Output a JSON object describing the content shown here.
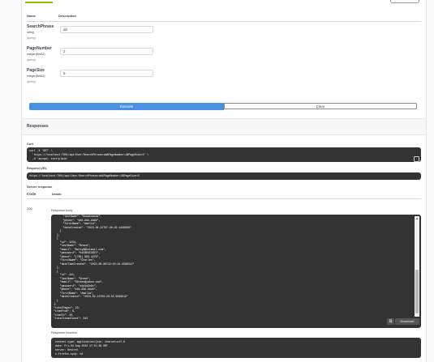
{
  "params_table": {
    "name_header": "Name",
    "desc_header": "Description"
  },
  "params": [
    {
      "name": "SearchPhrase",
      "type": "string",
      "in": "(query)",
      "value": "ab"
    },
    {
      "name": "PageNumber",
      "type": "integer($int32)",
      "in": "(query)",
      "value": "2"
    },
    {
      "name": "PageSize",
      "type": "integer($int32)",
      "in": "(query)",
      "value": "5"
    }
  ],
  "buttons": {
    "execute": "Execute",
    "clear": "Clear"
  },
  "responses_title": "Responses",
  "curl": {
    "label": "Curl",
    "lines": [
      "curl -X 'GET' \\",
      "  'https://localhost:7001/api/User/SearchPhrase=ab&PageNumber=2&PageSize=5' \\",
      "  -H 'accept: text/plain'"
    ]
  },
  "request_url": {
    "label": "Request URL",
    "value": "https://localhost:7001/api/User/SearchPhrase=ab&PageNumber=2&PageSize=5"
  },
  "server_response": {
    "label": "Server response",
    "code_header": "Code",
    "details_header": "Details",
    "code": "200"
  },
  "response_body": {
    "label": "Response body",
    "lines": [
      "      \"lastName\": \"Nowakowska\",",
      "      \"phone\": \"###-###-####\",",
      "      \"firstName\": \"Amelia\",",
      "      \"dateCreated\": \"2023-08-22T07:40:29.1446008\"",
      "    }",
      "  ],",
      "  {",
      "    \"id\": 1234,",
      "    \"lastName\": \"Brand\",",
      "    \"email\": \"BettyB@hotmail.com\",",
      "    \"password\": \"hxD8B4CXNTE\",",
      "    \"phone\": \"(785) 693-4279\",",
      "    \"firstName\": \"Charles\",",
      "    \"dateTimeCreated\": \"2023-08-06T22:03:18.4586512\"",
      "  },",
      "  {",
      "    \"id\": 441,",
      "    \"lastName\": \"Green\",",
      "    \"email\": \"SGreen@yahoo.com\",",
      "    \"password\": \"zkp3d3n8s\",",
      "    \"phone\": \"###-###-####\",",
      "    \"firstName\": \"Amelia\",",
      "    \"dateCreated\": \"2023-02-13T09:23:52.9569012\"",
      "  }",
      "],",
      "\"totalPages\": 29,",
      "\"itemFrom\": 6,",
      "\"itemTo\": 10,",
      "\"totalItemsCount\": 144"
    ],
    "download": "Download"
  },
  "response_headers": {
    "label": "Response headers",
    "lines": [
      " content-type: application/json; charset=utf-8",
      " date: Fri,04 Aug 2023 17:51:39 GMT",
      " server: Kestrel",
      " x-firefox-spdy: h2"
    ]
  },
  "colors": {
    "execute": "#4990e2",
    "code_bg": "#333333",
    "tab_accent": "#89bf04"
  }
}
